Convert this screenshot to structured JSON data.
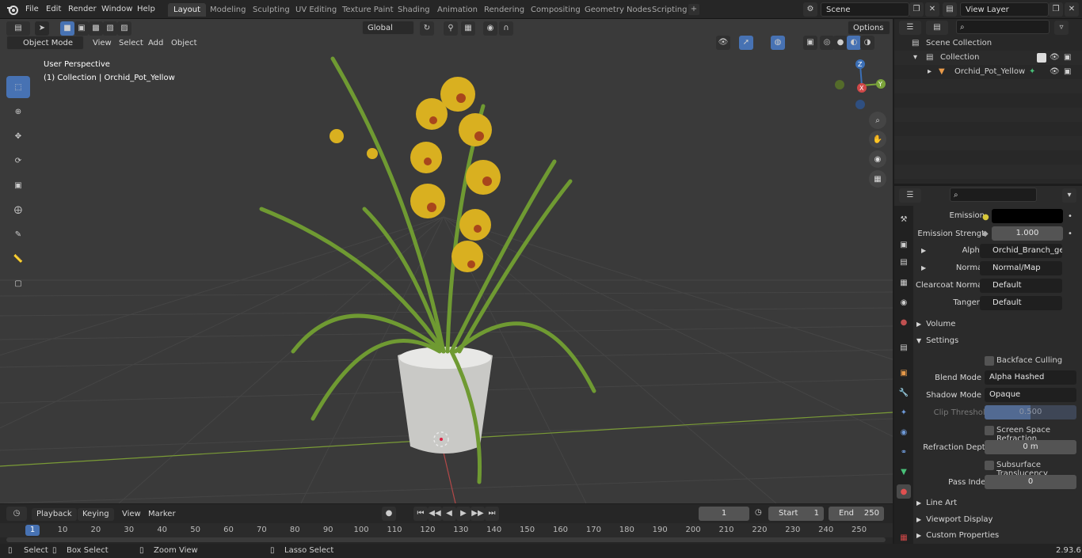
{
  "app": {
    "version": "2.93.6"
  },
  "menu": [
    "File",
    "Edit",
    "Render",
    "Window",
    "Help"
  ],
  "workspaces": [
    {
      "label": "Layout",
      "active": true
    },
    {
      "label": "Modeling"
    },
    {
      "label": "Sculpting"
    },
    {
      "label": "UV Editing"
    },
    {
      "label": "Texture Paint"
    },
    {
      "label": "Shading"
    },
    {
      "label": "Animation"
    },
    {
      "label": "Rendering"
    },
    {
      "label": "Compositing"
    },
    {
      "label": "Geometry Nodes"
    },
    {
      "label": "Scripting"
    }
  ],
  "scene": {
    "label": "Scene"
  },
  "view_layer": {
    "label": "View Layer"
  },
  "viewport": {
    "mode": "Object Mode",
    "menu": [
      "View",
      "Select",
      "Add",
      "Object"
    ],
    "transform": "Global",
    "options": "Options",
    "overlay_title": "User Perspective",
    "overlay_subtitle": "(1) Collection | Orchid_Pot_Yellow",
    "gizmo": {
      "x": "X",
      "y": "Y",
      "z": "Z"
    }
  },
  "outliner": {
    "root": "Scene Collection",
    "collection": "Collection",
    "object": "Orchid_Pot_Yellow"
  },
  "properties": {
    "emission_label": "Emission",
    "emission_strength_label": "Emission Strengt",
    "emission_strength": "1.000",
    "alpha_label": "Alpha",
    "alpha_value": "Orchid_Branch_geo_...",
    "normal_label": "Normal",
    "normal_value": "Normal/Map",
    "clearcoat_label": "Clearcoat Normal",
    "clearcoat_value": "Default",
    "tangent_label": "Tangent",
    "tangent_value": "Default",
    "volume": "Volume",
    "settings": "Settings",
    "backface_culling": "Backface Culling",
    "blend_mode_label": "Blend Mode",
    "blend_mode": "Alpha Hashed",
    "shadow_mode_label": "Shadow Mode",
    "shadow_mode": "Opaque",
    "clip_threshold_label": "Clip Threshold",
    "clip_threshold": "0.500",
    "ssr": "Screen Space Refraction",
    "refraction_depth_label": "Refraction Depth",
    "refraction_depth": "0 m",
    "subsurface": "Subsurface Translucency",
    "pass_index_label": "Pass Index",
    "pass_index": "0",
    "line_art": "Line Art",
    "viewport_display": "Viewport Display",
    "custom_properties": "Custom Properties"
  },
  "timeline": {
    "menu": [
      "Playback",
      "Keying",
      "View",
      "Marker"
    ],
    "current_frame": "1",
    "start_label": "Start",
    "start": "1",
    "end_label": "End",
    "end": "250",
    "ruler": [
      "1",
      "10",
      "20",
      "30",
      "40",
      "50",
      "60",
      "70",
      "80",
      "90",
      "100",
      "110",
      "120",
      "130",
      "140",
      "150",
      "160",
      "170",
      "180",
      "190",
      "200",
      "210",
      "220",
      "230",
      "240",
      "250"
    ]
  },
  "status": {
    "select": "Select",
    "box_select": "Box Select",
    "zoom_view": "Zoom View",
    "lasso_select": "Lasso Select"
  },
  "colors": {
    "accent": "#4772b3",
    "grid_x": "#7a9b36",
    "axis_red": "#b34848"
  }
}
